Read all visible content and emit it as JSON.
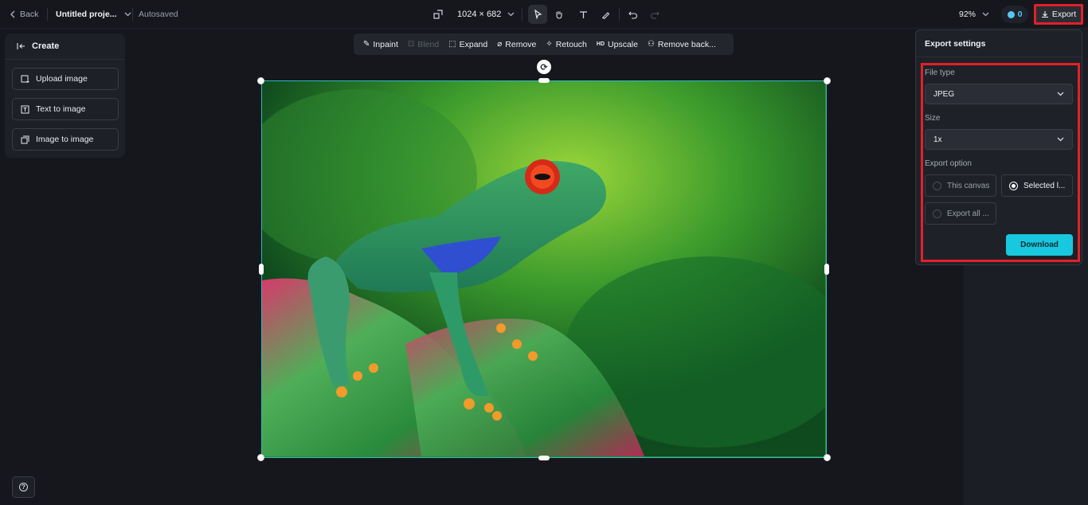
{
  "topbar": {
    "back_label": "Back",
    "project_name": "Untitled proje...",
    "autosaved_label": "Autosaved",
    "canvas_size": "1024 × 682",
    "zoom": "92%",
    "credits": "0",
    "export_label": "Export"
  },
  "tools": [
    "select-icon",
    "hand-icon",
    "text-icon",
    "pen-icon",
    "undo-icon",
    "redo-icon"
  ],
  "left_panel": {
    "title": "Create",
    "buttons": [
      {
        "label": "Upload image",
        "icon": "upload-image-icon"
      },
      {
        "label": "Text to image",
        "icon": "text-to-image-icon"
      },
      {
        "label": "Image to image",
        "icon": "image-to-image-icon"
      }
    ]
  },
  "edit_toolbar": {
    "items": [
      {
        "label": "Inpaint",
        "icon": "inpaint-icon",
        "enabled": true
      },
      {
        "label": "Blend",
        "icon": "blend-icon",
        "enabled": false
      },
      {
        "label": "Expand",
        "icon": "expand-icon",
        "enabled": true
      },
      {
        "label": "Remove",
        "icon": "eraser-icon",
        "enabled": true
      },
      {
        "label": "Retouch",
        "icon": "retouch-icon",
        "enabled": true
      },
      {
        "label": "Upscale",
        "icon": "hd-icon",
        "enabled": true
      },
      {
        "label": "Remove back...",
        "icon": "remove-background-icon",
        "enabled": true
      }
    ]
  },
  "export_panel": {
    "title": "Export settings",
    "file_type_label": "File type",
    "file_type_value": "JPEG",
    "size_label": "Size",
    "size_value": "1x",
    "export_option_label": "Export option",
    "options": [
      {
        "label": "This canvas",
        "selected": false
      },
      {
        "label": "Selected l...",
        "selected": true
      },
      {
        "label": "Export all ...",
        "selected": false
      }
    ],
    "download_label": "Download"
  },
  "colors": {
    "background": "#15171d",
    "accent": "#18c8df",
    "highlight": "#e3202a",
    "selection": "#2fb9c2"
  }
}
